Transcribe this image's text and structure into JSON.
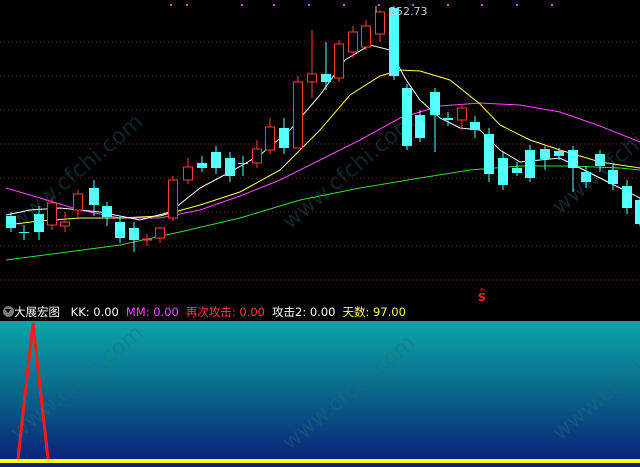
{
  "main_chart": {
    "price_label": "252.73",
    "marker_label": "S",
    "colors": {
      "up": "#ff3b3b",
      "down": "#54ffff",
      "ma_short": "#ffffff",
      "ma_mid": "#ffff55",
      "ma_long": "#ff44ff",
      "ma_longer": "#33dd33",
      "grid": "#8b1a1a",
      "dots": "#ff44ff"
    }
  },
  "indicator": {
    "name": "大展宏图",
    "items": [
      {
        "label": "KK:",
        "value": "0.00",
        "color": "#ffffff"
      },
      {
        "label": "MM:",
        "value": "0.00",
        "color": "#ff44ff"
      },
      {
        "label": "再次攻击:",
        "value": "0.00",
        "color": "#ff3b3b"
      },
      {
        "label": "攻击2:",
        "value": "0.00",
        "color": "#ffffff"
      },
      {
        "label": "天数:",
        "value": "97.00",
        "color": "#ffff55"
      }
    ]
  },
  "watermark": "www.cfchi.com"
}
